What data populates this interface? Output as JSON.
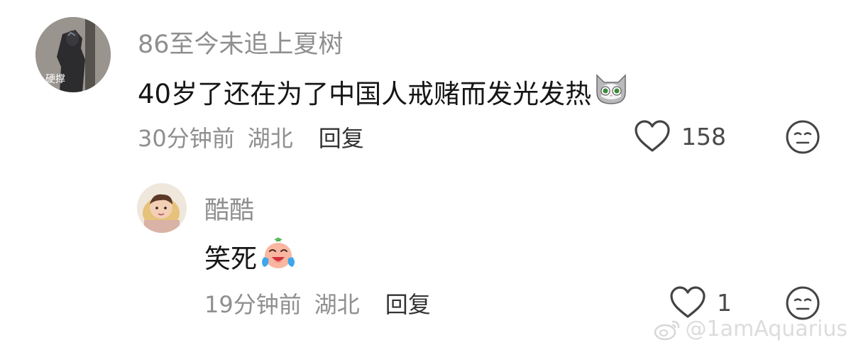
{
  "comments": [
    {
      "username": "86至今未追上夏树",
      "avatar_text": "硬撑",
      "text": "40岁了还在为了中国人戒赌而发光发热",
      "emoji_icon": "cat-face-emoji",
      "time": "30分钟前",
      "location": "湖北",
      "reply_label": "回复",
      "likes": "158"
    },
    {
      "username": "酷酷",
      "text": "笑死",
      "emoji_icon": "laughing-tears-emoji",
      "time": "19分钟前",
      "location": "湖北",
      "reply_label": "回复",
      "likes": "1"
    }
  ],
  "watermark": {
    "handle": "@1amAquarius",
    "icon": "weibo-icon"
  },
  "colors": {
    "meta_text": "#8f8f8f",
    "main_text": "#161616",
    "icon_stroke": "#444444"
  }
}
